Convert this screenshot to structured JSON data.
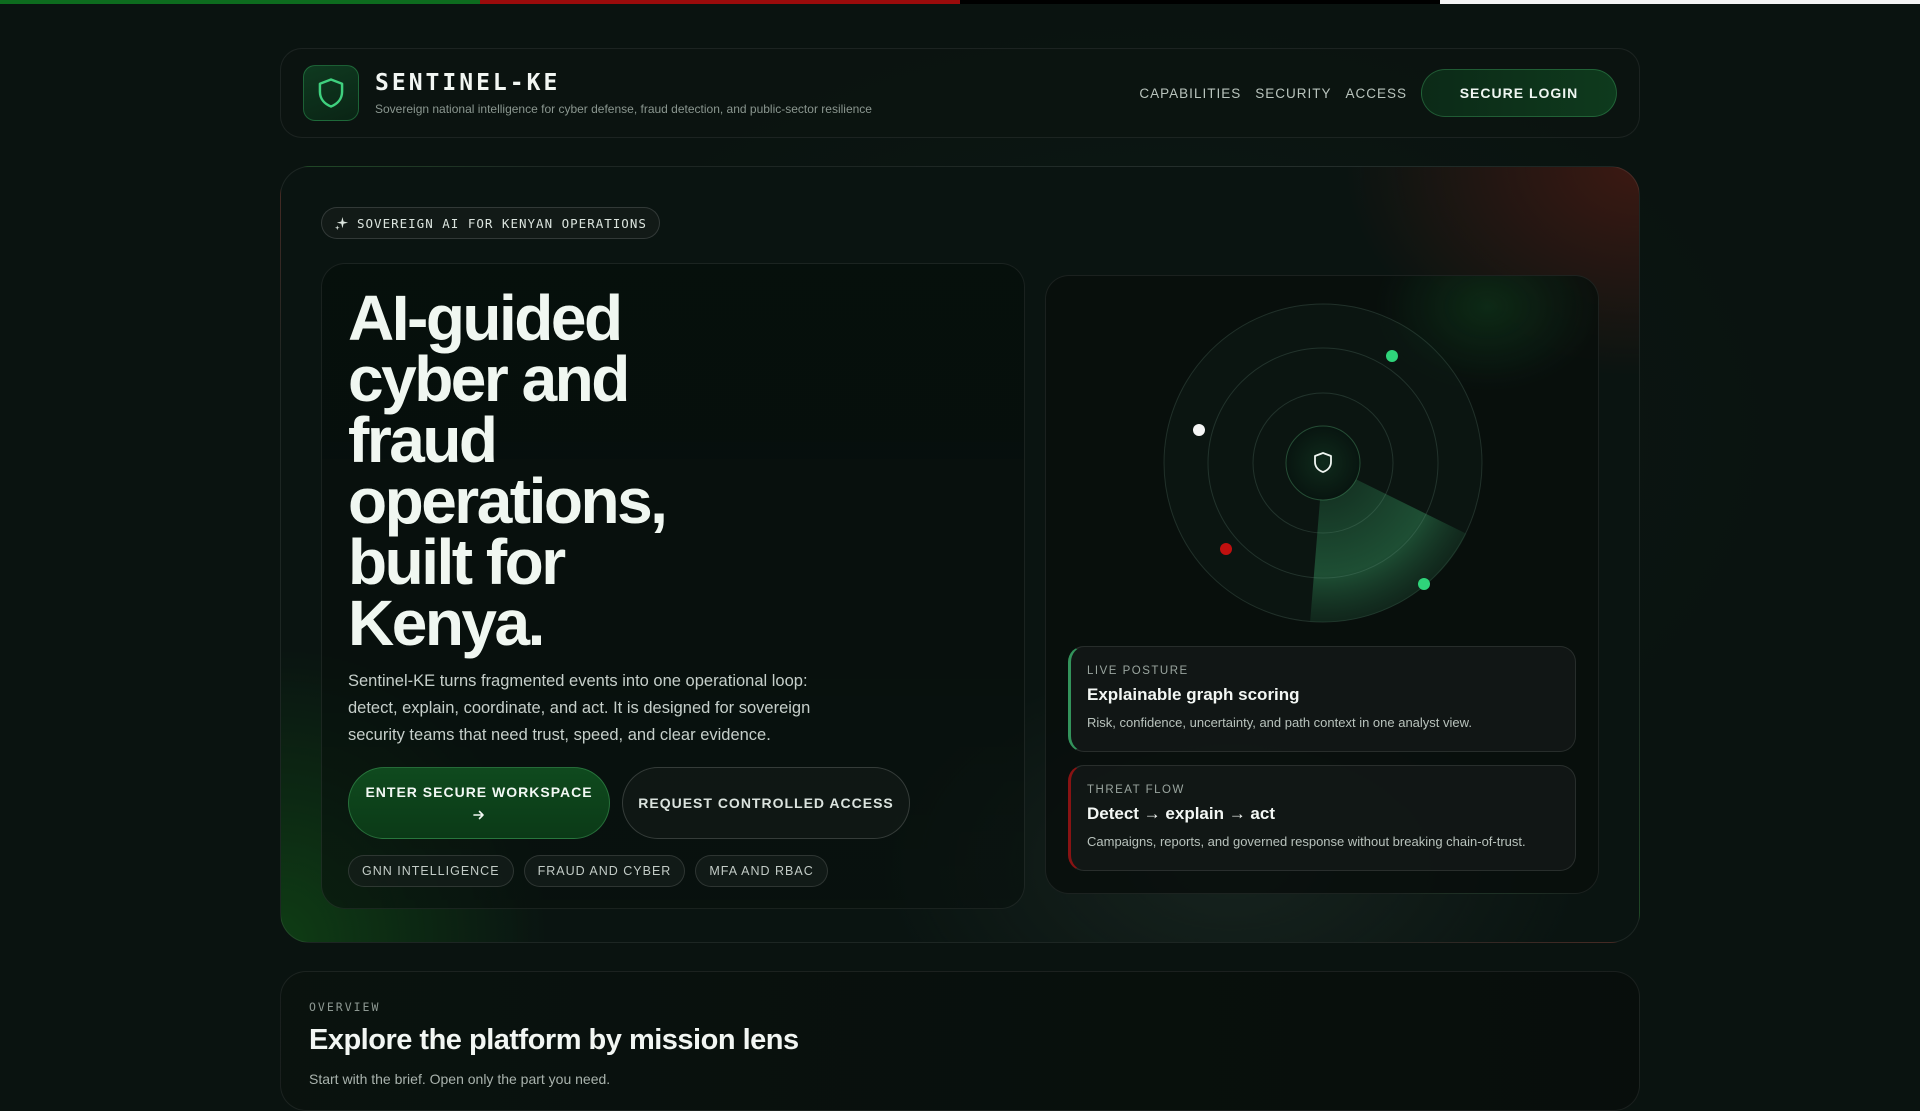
{
  "colors": {
    "flag_green": "#0d6b1e",
    "flag_red": "#9a0b0b",
    "flag_black": "#000000",
    "flag_white": "#f4f4f4",
    "accent_green": "#2fd47a",
    "alert_red": "#c0100f"
  },
  "header": {
    "brand_name": "SENTINEL-KE",
    "brand_tagline": "Sovereign national intelligence for cyber defense, fraud detection, and public-sector resilience",
    "logo_icon": "shield-icon",
    "nav": [
      "CAPABILITIES",
      "SECURITY",
      "ACCESS"
    ],
    "login_label": "SECURE LOGIN"
  },
  "hero": {
    "pill_icon": "sparkles-icon",
    "pill_label": "SOVEREIGN AI FOR KENYAN OPERATIONS",
    "headline": "AI-guided\ncyber and\nfraud\noperations,\nbuilt for\nKenya.",
    "description": "Sentinel-KE turns fragmented events into one operational loop: detect, explain, coordinate, and act. It is designed for sovereign security teams that need trust, speed, and clear evidence.",
    "primary_cta": "ENTER SECURE WORKSPACE",
    "primary_cta_icon": "arrow-right-icon",
    "secondary_cta": "REQUEST CONTROLLED ACCESS",
    "tags": [
      "GNN INTELLIGENCE",
      "FRAUD AND CYBER",
      "MFA AND RBAC"
    ]
  },
  "panel": {
    "radar_icon": "shield-icon",
    "cards": [
      {
        "kicker": "LIVE POSTURE",
        "title": "Explainable graph scoring",
        "text": "Risk, confidence, uncertainty, and path context in one analyst view."
      },
      {
        "kicker": "THREAT FLOW",
        "title": "Detect → explain → act",
        "text": "Campaigns, reports, and governed response without breaking chain-of-trust."
      }
    ]
  },
  "overview": {
    "kicker": "OVERVIEW",
    "title": "Explore the platform by mission lens",
    "subtitle": "Start with the brief. Open only the part you need."
  }
}
